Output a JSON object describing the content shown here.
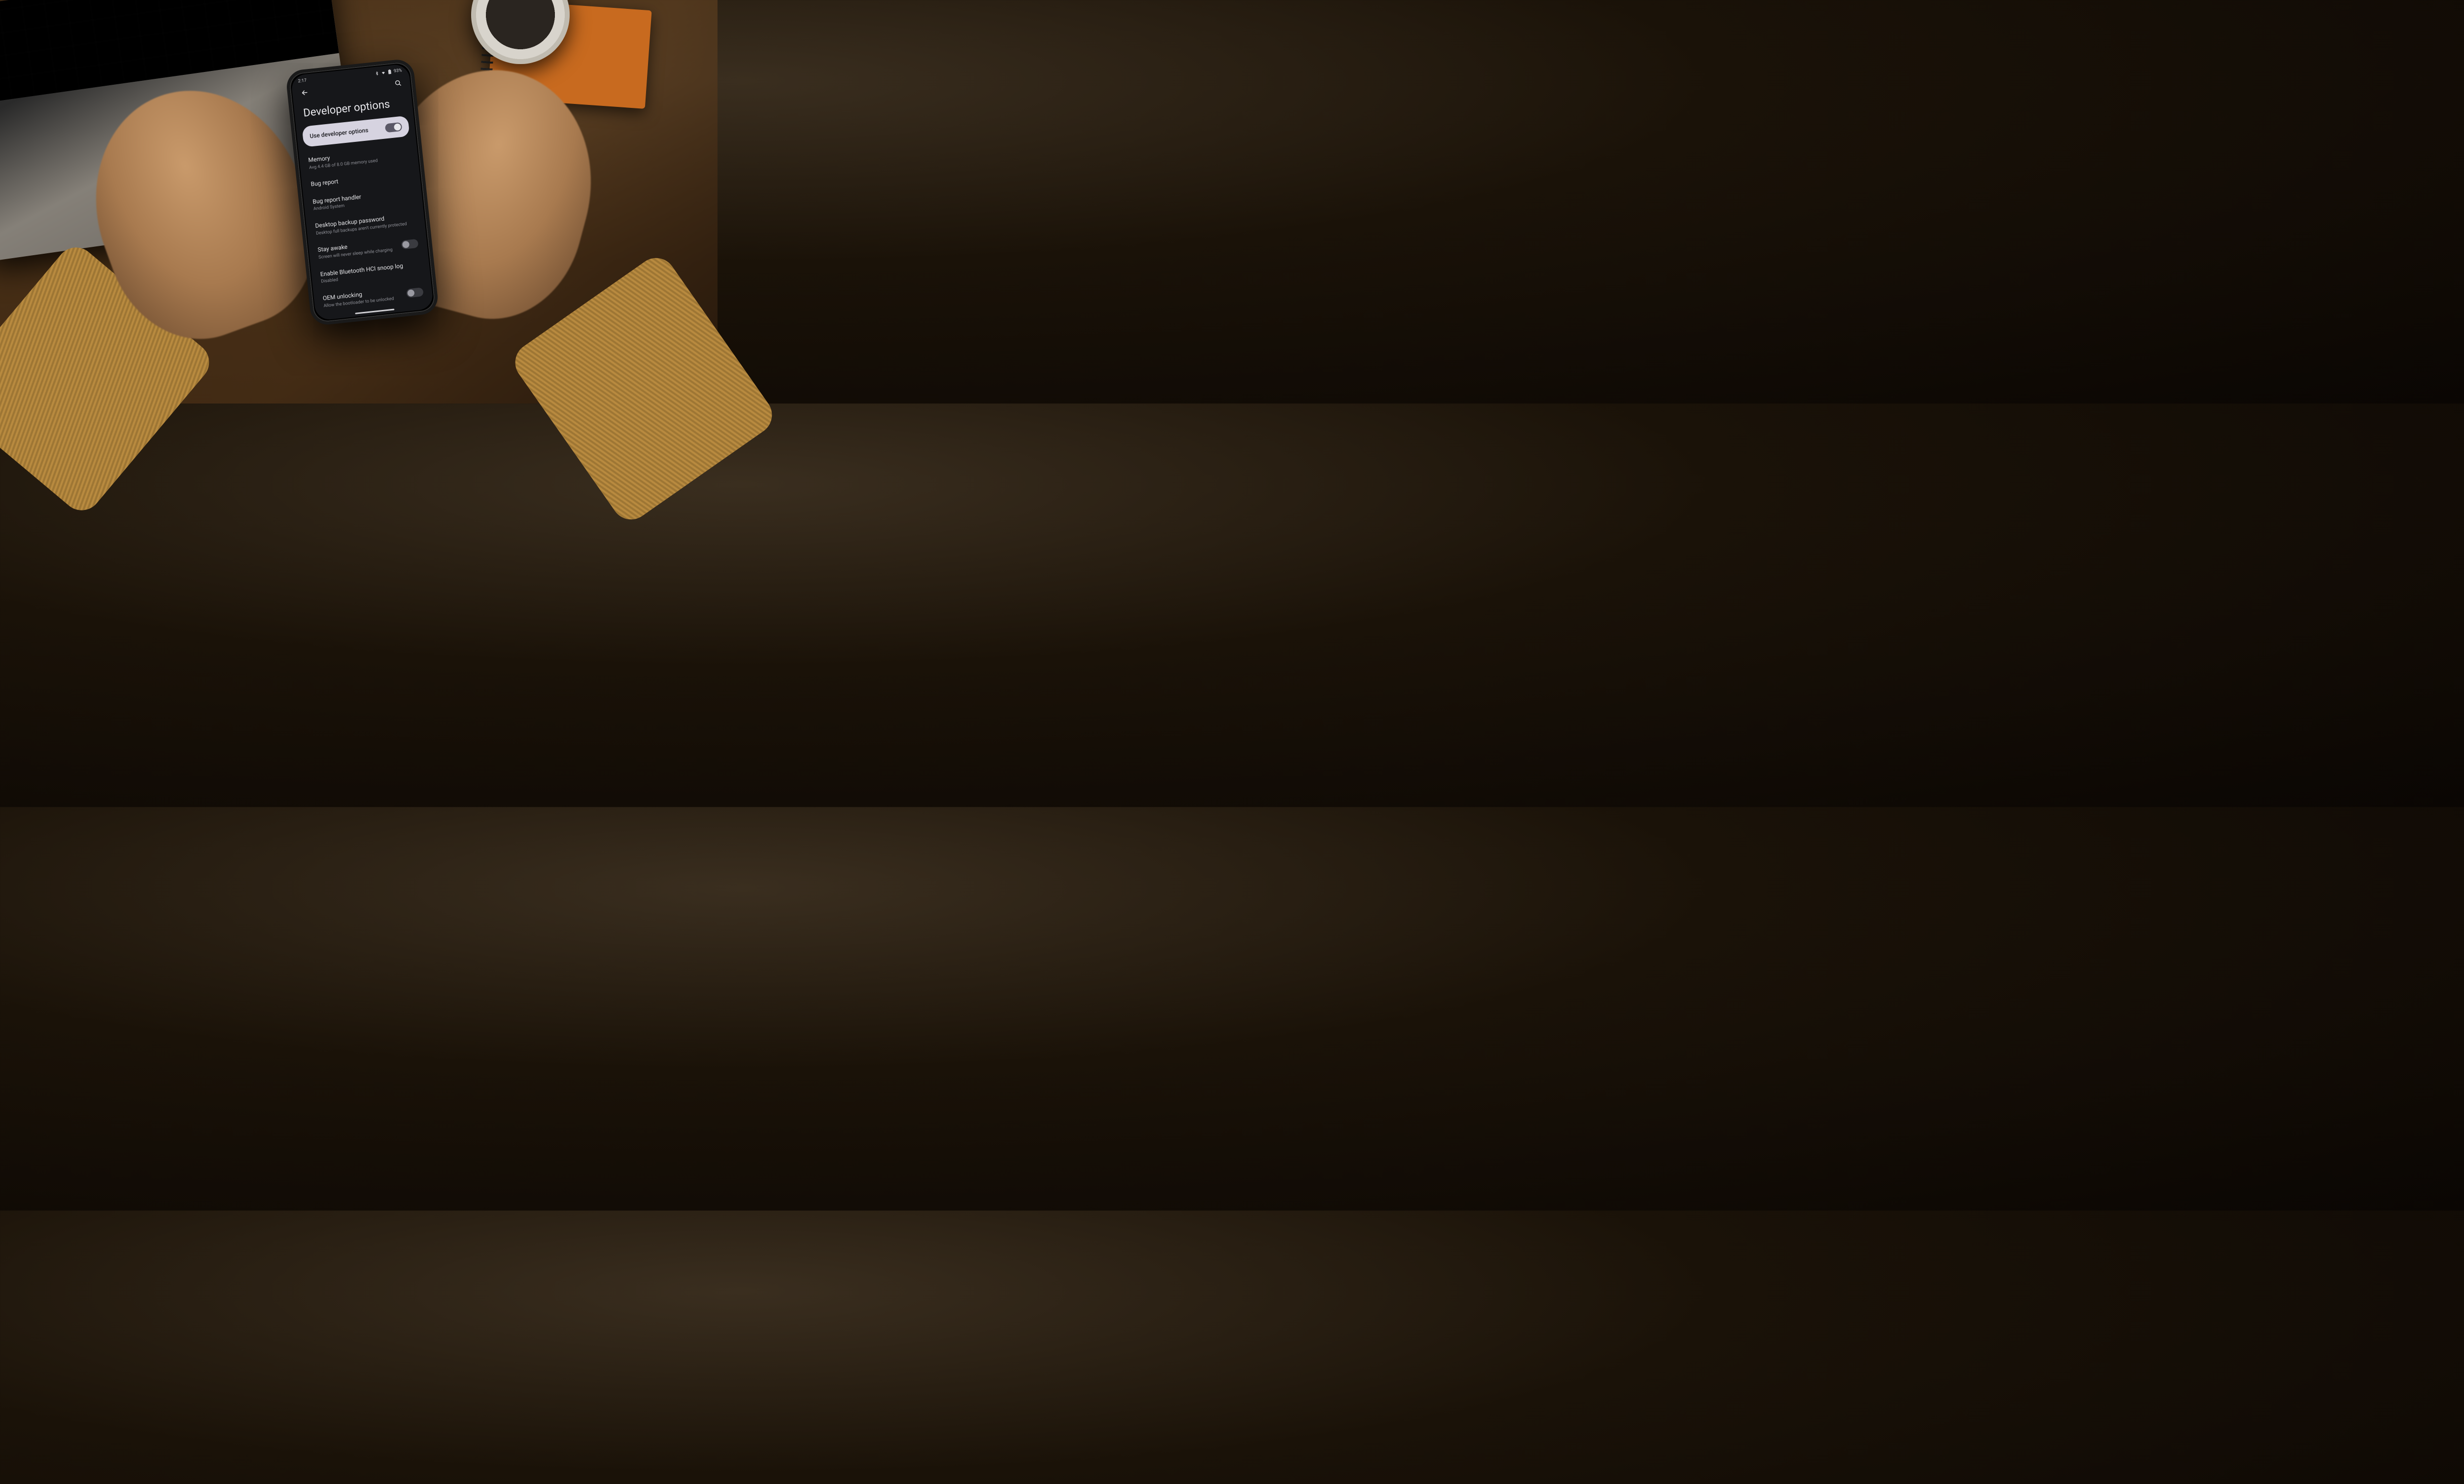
{
  "status_bar": {
    "time": "2:17",
    "battery_text": "93%"
  },
  "header": {
    "title": "Developer options"
  },
  "master_toggle": {
    "label": "Use developer options",
    "on": true
  },
  "settings": [
    {
      "key": "memory",
      "title": "Memory",
      "sub": "Avg 4.4 GB of 8.0 GB memory used",
      "has_switch": false
    },
    {
      "key": "bug-report",
      "title": "Bug report",
      "sub": "",
      "has_switch": false
    },
    {
      "key": "bug-handler",
      "title": "Bug report handler",
      "sub": "Android System",
      "has_switch": false
    },
    {
      "key": "desktop-backup",
      "title": "Desktop backup password",
      "sub": "Desktop full backups aren't currently protected",
      "has_switch": false
    },
    {
      "key": "stay-awake",
      "title": "Stay awake",
      "sub": "Screen will never sleep while charging",
      "has_switch": true,
      "on": false
    },
    {
      "key": "bt-hci",
      "title": "Enable Bluetooth HCI snoop log",
      "sub": "Disabled",
      "has_switch": false
    },
    {
      "key": "oem-unlock",
      "title": "OEM unlocking",
      "sub": "Allow the bootloader to be unlocked",
      "has_switch": true,
      "on": false
    }
  ]
}
